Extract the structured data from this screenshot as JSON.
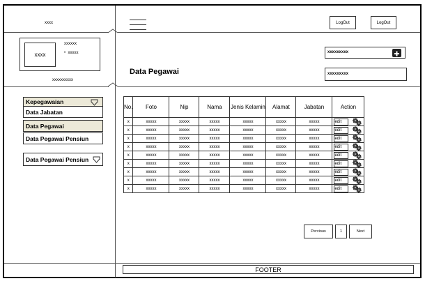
{
  "header": {
    "logo_text": "xxxx",
    "logout_buttons": [
      "LogOut",
      "LogOut"
    ]
  },
  "profile": {
    "avatar_text": "xxxx",
    "line1": "xxxxxx",
    "line2": "xxxxx",
    "name": "xxxxxxxxxx"
  },
  "sidebar": {
    "group1_label": "Kepegawaian",
    "items": [
      "Data Jabatan",
      "Data Pegawai",
      "Data Pegawai Pensiun"
    ],
    "group2_label": "Data Pegawai Pensiun"
  },
  "main": {
    "page_title": "Data Pegawai",
    "search_value": "xxxxxxxxx",
    "filter_value": "xxxxxxxxx"
  },
  "table": {
    "columns": [
      "No.",
      "Foto",
      "Nip",
      "Nama",
      "Jenis Kelamin",
      "Alamat",
      "Jabatan",
      "Action"
    ],
    "edit_label": "edit",
    "rows": [
      [
        "x",
        "xxxxx",
        "xxxxx",
        "xxxxx",
        "xxxxx",
        "xxxxx",
        "xxxxx"
      ],
      [
        "x",
        "xxxxx",
        "xxxxx",
        "xxxxx",
        "xxxxx",
        "xxxxx",
        "xxxxx"
      ],
      [
        "x",
        "xxxxx",
        "xxxxx",
        "xxxxx",
        "xxxxx",
        "xxxxx",
        "xxxxx"
      ],
      [
        "x",
        "xxxxx",
        "xxxxx",
        "xxxxx",
        "xxxxx",
        "xxxxx",
        "xxxxx"
      ],
      [
        "x",
        "xxxxx",
        "xxxxx",
        "xxxxx",
        "xxxxx",
        "xxxxx",
        "xxxxx"
      ],
      [
        "x",
        "xxxxx",
        "xxxxx",
        "xxxxx",
        "xxxxx",
        "xxxxx",
        "xxxxx"
      ],
      [
        "x",
        "xxxxx",
        "xxxxx",
        "xxxxx",
        "xxxxx",
        "xxxxx",
        "xxxxx"
      ],
      [
        "x",
        "xxxxx",
        "xxxxx",
        "xxxxx",
        "xxxxx",
        "xxxxx",
        "xxxxx"
      ],
      [
        "x",
        "xxxxx",
        "xxxxx",
        "xxxxx",
        "xxxxx",
        "xxxxx",
        "xxxxx"
      ]
    ]
  },
  "pagination": {
    "prev_label": "Pervious",
    "page_number": "1",
    "next_label": "Next"
  },
  "footer": {
    "text": "FOOTER"
  }
}
